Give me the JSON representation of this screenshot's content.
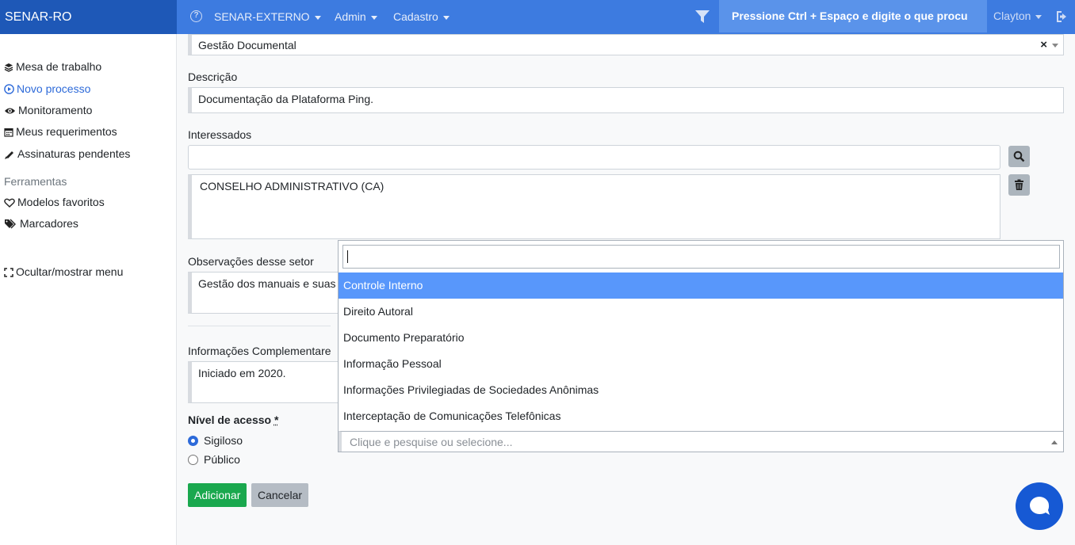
{
  "brand": "SENAR-RO",
  "nav": {
    "items": [
      {
        "label": "SENAR-EXTERNO"
      },
      {
        "label": "Admin"
      },
      {
        "label": "Cadastro"
      }
    ],
    "search_text": "Pressione Ctrl + Espaço e digite o que procu",
    "user": "Clayton"
  },
  "sidebar": {
    "items": [
      {
        "label": "Mesa de trabalho",
        "icon": "layers-icon"
      },
      {
        "label": "Novo processo",
        "icon": "play-circle-icon"
      },
      {
        "label": "Monitoramento",
        "icon": "eye-icon"
      },
      {
        "label": "Meus requerimentos",
        "icon": "calendar-icon"
      },
      {
        "label": "Assinaturas pendentes",
        "icon": "pen-icon"
      }
    ],
    "tools_heading": "Ferramentas",
    "tools": [
      {
        "label": "Modelos favoritos",
        "icon": "heart-icon"
      },
      {
        "label": "Marcadores",
        "icon": "tags-icon"
      }
    ],
    "toggle_label": "Ocultar/mostrar menu"
  },
  "form": {
    "top_select_value": "Gestão Documental",
    "top_select_clear": "×",
    "descricao_label": "Descrição",
    "descricao_value": "Documentação da Plataforma Ping.",
    "interessados_label": "Interessados",
    "interessados_value": "CONSELHO ADMINISTRATIVO (CA)",
    "observacoes_label": "Observações desse setor",
    "observacoes_value": "Gestão dos manuais e suas",
    "informacoes_label": "Informações Complementare",
    "informacoes_value": "Iniciado em 2020.",
    "nivel_label": "Nível de acesso",
    "required_mark": "*",
    "radios": [
      {
        "label": "Sigiloso",
        "checked": true
      },
      {
        "label": "Público",
        "checked": false
      }
    ],
    "add_button": "Adicionar",
    "cancel_button": "Cancelar"
  },
  "dropdown": {
    "search_value": "",
    "options": [
      "Controle Interno",
      "Direito Autoral",
      "Documento Preparatório",
      "Informação Pessoal",
      "Informações Privilegiadas de Sociedades Anônimas",
      "Interceptação de Comunicações Telefônicas"
    ],
    "highlighted_index": 0,
    "placeholder": "Clique e pesquise ou selecione..."
  },
  "colors": {
    "topbar": "#3d7be0",
    "brand_bg": "#1e58b7",
    "highlight": "#5897fb",
    "add_button": "#1aa84e",
    "chat": "#1659d4"
  }
}
